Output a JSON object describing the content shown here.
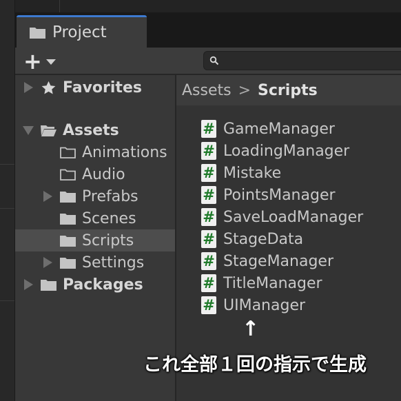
{
  "tab": {
    "label": "Project"
  },
  "toolbar": {
    "add_label": "+",
    "search_placeholder": ""
  },
  "tree": {
    "items": [
      {
        "label": "Favorites",
        "icon": "star-icon",
        "bold": true,
        "arrow": "right",
        "level": 0
      },
      {
        "label": "Assets",
        "icon": "folder-open-icon",
        "bold": true,
        "arrow": "down",
        "level": 0
      },
      {
        "label": "Animations",
        "icon": "folder-outline-icon",
        "bold": false,
        "arrow": "none",
        "level": 1
      },
      {
        "label": "Audio",
        "icon": "folder-outline-icon",
        "bold": false,
        "arrow": "none",
        "level": 1
      },
      {
        "label": "Prefabs",
        "icon": "folder-icon",
        "bold": false,
        "arrow": "right",
        "level": 1
      },
      {
        "label": "Scenes",
        "icon": "folder-icon",
        "bold": false,
        "arrow": "none",
        "level": 1
      },
      {
        "label": "Scripts",
        "icon": "folder-icon",
        "bold": false,
        "arrow": "none",
        "level": 1,
        "selected": true
      },
      {
        "label": "Settings",
        "icon": "folder-icon",
        "bold": false,
        "arrow": "right",
        "level": 1
      },
      {
        "label": "Packages",
        "icon": "folder-icon",
        "bold": true,
        "arrow": "right",
        "level": 0
      }
    ]
  },
  "breadcrumb": {
    "root": "Assets",
    "separator": ">",
    "current": "Scripts"
  },
  "files": [
    "GameManager",
    "LoadingManager",
    "Mistake",
    "PointsManager",
    "SaveLoadManager",
    "StageData",
    "StageManager",
    "TitleManager",
    "UIManager"
  ],
  "file_icon": "csharp-script-icon",
  "file_icon_glyph": "#",
  "annotation": {
    "arrow": "↑",
    "text": "これ全部１回の指示で生成"
  },
  "colors": {
    "tab_accent": "#3d7ad0",
    "panel_bg": "#383838",
    "selected_row": "#4d4d4d",
    "cs_icon_hash": "#1f7a2a"
  }
}
